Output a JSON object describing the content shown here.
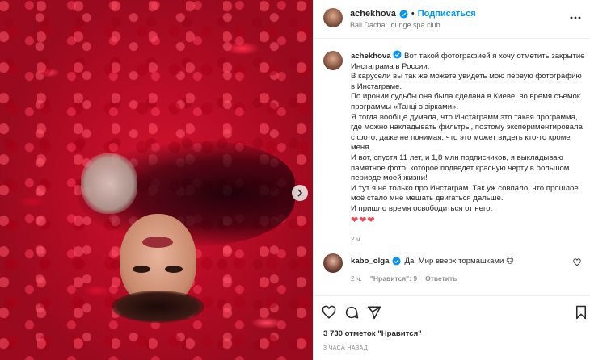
{
  "post": {
    "username": "achekhova",
    "follow_label": "Подписаться",
    "dot": "•",
    "location": "Bali Dacha: lounge spa club"
  },
  "caption": {
    "username": "achekhova",
    "lines": [
      "Вот такой фотографией я хочу отметить закрытие Инстаграма в России.",
      "В карусели вы так же можете увидеть мою первую фотографию в Инстаграме.",
      "По иронии судьбы она была сделана в Киеве, во время съемок программы «Танці з зірками».",
      "Я тогда вообще думала, что Инстаграмм это такая программа, где можно накладывать фильтры, поэтому экспериментировала с фото, даже не понимая, что это может видеть кто-то кроме меня.",
      "И вот, спустя 11 лет, и 1,8 млн подписчиков, я выкладываю памятное фото, которое подведет красную черту в большом периоде моей жизни!",
      "И тут я не только про Инстаграм. Так уж совпало, что прошлое моё стало мне мешать двигаться дальше.",
      "И пришло время освободиться от него."
    ],
    "hearts": "❤❤❤",
    "time": "2 ч."
  },
  "comment": {
    "username": "kabo_olga",
    "text": "Да! Мир вверх тормашками 🙃",
    "time": "2 ч.",
    "likes": "\"Нравится\": 9",
    "reply": "Ответить"
  },
  "footer": {
    "likes": "3 730 отметок \"Нравится\"",
    "ago": "3 ЧАСА НАЗАД"
  },
  "icons": {
    "verified": "verified-badge-icon",
    "more": "more-options-icon",
    "like": "heart-icon",
    "comment": "comment-icon",
    "share": "share-icon",
    "save": "bookmark-icon",
    "next": "chevron-right-icon"
  },
  "colors": {
    "accent": "#0095f6",
    "text": "#262626",
    "muted": "#8e8e8e",
    "heart": "#ed4956"
  }
}
